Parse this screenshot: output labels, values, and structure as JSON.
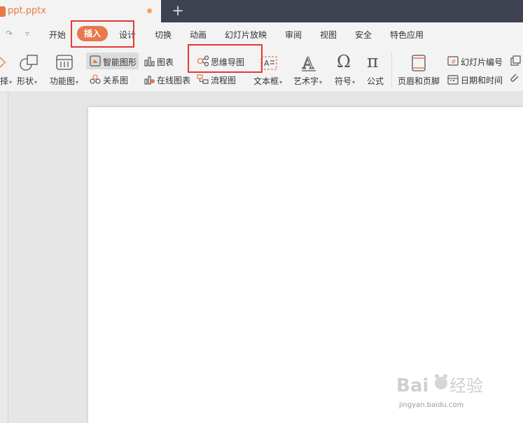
{
  "window": {
    "doc_tab_title": "ppt.pptx",
    "new_tab_symbol": "+",
    "colors": {
      "accent": "#e8794a",
      "titlebar": "#3e4150",
      "highlight": "#e53935"
    }
  },
  "quick_access": {
    "redo_symbol": "↷",
    "customize_symbol": "▿"
  },
  "menu": {
    "items": [
      "开始",
      "插入",
      "设计",
      "切换",
      "动画",
      "幻灯片放映",
      "审阅",
      "视图",
      "安全",
      "特色应用"
    ],
    "active": "插入"
  },
  "ribbon": {
    "partial_left_label": "择",
    "shape": "形状",
    "feature_chart": "功能图",
    "smart_graphic": "智能图形",
    "chart": "图表",
    "mind_map": "思维导图",
    "relationship": "关系图",
    "online_chart": "在线图表",
    "flowchart": "流程图",
    "textbox": "文本框",
    "wordart": "艺术字",
    "symbol": "符号",
    "formula": "公式",
    "header_footer": "页眉和页脚",
    "slide_number": "幻灯片编号",
    "date_time": "日期和时间",
    "icons": {
      "symbol_glyph": "Ω",
      "formula_glyph": "π",
      "wordart_glyph": "A"
    }
  },
  "watermark": {
    "text": "jingyan.baidu.com"
  }
}
